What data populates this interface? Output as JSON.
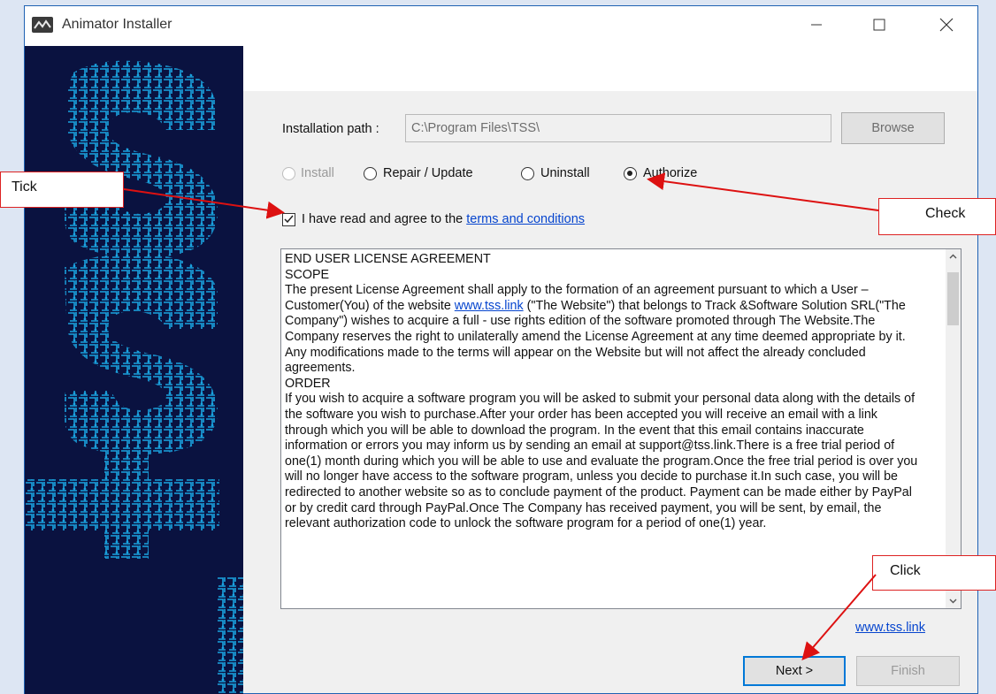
{
  "window": {
    "title": "Animator Installer"
  },
  "install_path": {
    "label": "Installation path :",
    "value": "C:\\Program Files\\TSS\\",
    "browse_label": "Browse"
  },
  "modes": [
    {
      "label": "Install",
      "checked": false,
      "disabled": true
    },
    {
      "label": "Repair / Update",
      "checked": false,
      "disabled": false
    },
    {
      "label": "Uninstall",
      "checked": false,
      "disabled": false
    },
    {
      "label": "Authorize",
      "checked": true,
      "disabled": false
    }
  ],
  "agree": {
    "text": "I have read and agree to the",
    "link": "terms and conditions",
    "checked": true
  },
  "eula": {
    "heading": "END USER LICENSE AGREEMENT",
    "scope_title": "SCOPE",
    "scope_pre": "The present License Agreement shall apply to the formation of an agreement pursuant to which a User – Customer(You) of the website",
    "scope_link": "www.tss.link",
    "scope_post": "(\"The Website\") that belongs to Track &Software Solution SRL(\"The Company\") wishes to acquire a full - use rights edition of the software promoted through The Website.The Company reserves the right to unilaterally amend the License Agreement at any time deemed appropriate by it. Any modifications made to the terms will appear on the Website but will not affect the already concluded agreements.",
    "order_title": "ORDER",
    "order_text": "If you wish to acquire a software program you will be asked to submit your personal data along with the details of the software you wish to purchase.After your order has been accepted you will receive an email with a link through which you will be able to download the program. In the event that this email contains inaccurate information or errors you may inform us by sending an email at support@tss.link.There is a free trial period of one(1) month during which you will be able to use and evaluate the program.Once the free trial period is over you will no longer have access to the software program, unless you decide to purchase it.In such case, you will be redirected to another website so as to conclude payment of the product. Payment can be made either by PayPal or by credit card through PayPal.Once The Company has received payment, you will be sent, by email, the relevant authorization code to unlock the software program for a period of one(1) year."
  },
  "footer": {
    "website_link": "www.tss.link",
    "next_label": "Next >",
    "finish_label": "Finish"
  },
  "annotations": {
    "tick": "Tick",
    "check": "Check",
    "click": "Click"
  },
  "colors": {
    "sidebar_bg": "#0a1240",
    "sidebar_art": "#1aa3e0",
    "annotation_red": "#dd1111",
    "link_blue": "#0645ce"
  }
}
